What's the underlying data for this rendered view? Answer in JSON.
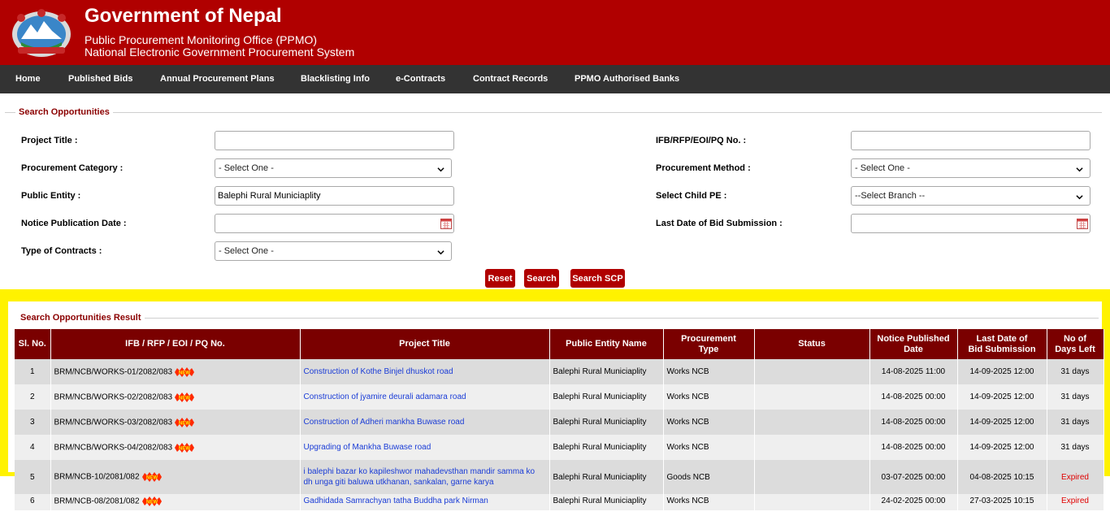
{
  "header": {
    "title": "Government of Nepal",
    "subtitle1": "Public Procurement Monitoring Office (PPMO)",
    "subtitle2": "National Electronic Government Procurement System"
  },
  "nav": {
    "items": [
      "Home",
      "Published Bids",
      "Annual Procurement Plans",
      "Blacklisting Info",
      "e-Contracts",
      "Contract Records",
      "PPMO Authorised Banks"
    ]
  },
  "search": {
    "legend": "Search Opportunities",
    "project_title_label": "Project Title :",
    "project_title_value": "",
    "ifb_label": "IFB/RFP/EOI/PQ No. :",
    "ifb_value": "",
    "category_label": "Procurement Category :",
    "category_value": "- Select One -",
    "method_label": "Procurement Method :",
    "method_value": "- Select One -",
    "entity_label": "Public Entity :",
    "entity_value": "Balephi Rural Municiaplity",
    "child_pe_label": "Select Child PE :",
    "child_pe_value": "--Select Branch --",
    "notice_date_label": "Notice Publication Date :",
    "notice_date_value": "",
    "last_date_label": "Last Date of Bid Submission :",
    "last_date_value": "",
    "contract_type_label": "Type of Contracts :",
    "contract_type_value": "- Select One -",
    "reset_label": "Reset",
    "search_label": "Search",
    "search_scp_label": "Search SCP"
  },
  "results": {
    "legend": "Search Opportunities Result",
    "headers": {
      "sl": "Sl. No.",
      "ifb": "IFB / RFP / EOI / PQ No.",
      "title": "Project Title",
      "entity": "Public Entity Name",
      "type_line1": "Procurement",
      "type_line2": "Type",
      "status": "Status",
      "notice_line1": "Notice Published",
      "notice_line2": "Date",
      "last_line1": "Last Date of",
      "last_line2": "Bid Submission",
      "days_line1": "No of",
      "days_line2": "Days Left"
    },
    "new_badge": "NEW",
    "rows": [
      {
        "sl": "1",
        "ifb": "BRM/NCB/WORKS-01/2082/083",
        "title": "Construction of Kothe Binjel dhuskot road",
        "entity": "Balephi Rural Municiaplity",
        "type": "Works  NCB",
        "status": "",
        "notice": "14-08-2025 11:00",
        "last": "14-09-2025 12:00",
        "days": "31 days"
      },
      {
        "sl": "2",
        "ifb": "BRM/NCB/WORKS-02/2082/083",
        "title": "Construction of jyamire deurali adamara road",
        "entity": "Balephi Rural Municiaplity",
        "type": "Works  NCB",
        "status": "",
        "notice": "14-08-2025 00:00",
        "last": "14-09-2025 12:00",
        "days": "31 days"
      },
      {
        "sl": "3",
        "ifb": "BRM/NCB/WORKS-03/2082/083",
        "title": "Construction of Adheri mankha Buwase road",
        "entity": "Balephi Rural Municiaplity",
        "type": "Works  NCB",
        "status": "",
        "notice": "14-08-2025 00:00",
        "last": "14-09-2025 12:00",
        "days": "31 days"
      },
      {
        "sl": "4",
        "ifb": "BRM/NCB/WORKS-04/2082/083",
        "title": "Upgrading of Mankha Buwase road",
        "entity": "Balephi Rural Municiaplity",
        "type": "Works  NCB",
        "status": "",
        "notice": "14-08-2025 00:00",
        "last": "14-09-2025 12:00",
        "days": "31 days"
      },
      {
        "sl": "5",
        "ifb": "BRM/NCB-10/2081/082",
        "title": "i balephi bazar ko kapileshwor mahadevsthan mandir samma ko dh unga giti baluwa utkhanan, sankalan, garne karya",
        "entity": "Balephi Rural Municiaplity",
        "type": "Goods  NCB",
        "status": "",
        "notice": "03-07-2025 00:00",
        "last": "04-08-2025 10:15",
        "days": "Expired"
      },
      {
        "sl": "6",
        "ifb": "BRM/NCB-08/2081/082",
        "title": "Gadhidada Samrachyan tatha Buddha park Nirman",
        "entity": "Balephi Rural Municiaplity",
        "type": "Works  NCB",
        "status": "",
        "notice": "24-02-2025 00:00",
        "last": "27-03-2025 10:15",
        "days": "Expired"
      }
    ]
  }
}
